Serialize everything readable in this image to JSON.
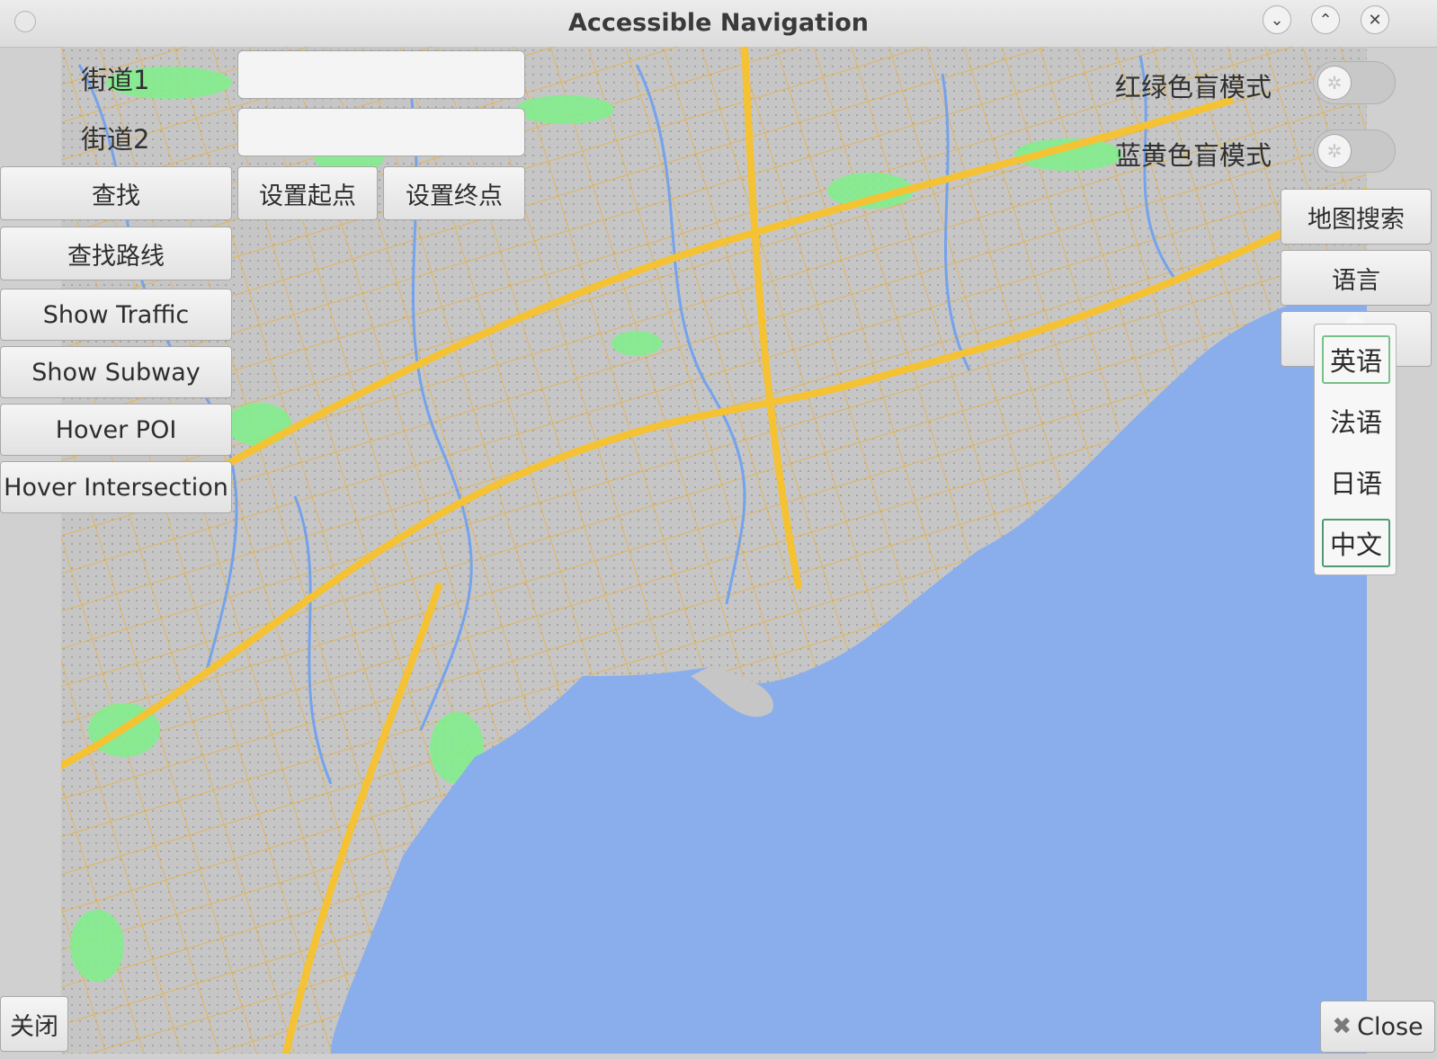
{
  "window": {
    "title": "Accessible Navigation"
  },
  "titlebar_icons": [
    "minimize-icon",
    "maximize-icon",
    "close-icon"
  ],
  "search_panel": {
    "street1_label": "街道1",
    "street2_label": "街道2",
    "street1_value": "",
    "street2_value": "",
    "find_button": "查找",
    "set_start_button": "设置起点",
    "set_end_button": "设置终点",
    "find_route_button": "查找路线",
    "show_traffic_button": "Show Traffic",
    "show_subway_button": "Show Subway",
    "hover_poi_button": "Hover POI",
    "hover_intersection_button": "Hover Intersection"
  },
  "right_panel": {
    "red_green_label": "红绿色盲模式",
    "blue_yellow_label": "蓝黄色盲模式",
    "red_green_on": false,
    "blue_yellow_on": false,
    "map_search_button": "地图搜索",
    "language_button": "语言"
  },
  "language_menu": {
    "items": [
      "英语",
      "法语",
      "日语",
      "中文"
    ],
    "focused_item": "英语",
    "selected_item": "中文"
  },
  "bottom": {
    "exit_button": "关闭",
    "close_button": "Close"
  },
  "colors": {
    "water": "#8aadec",
    "land": "#c6c6c6",
    "roads": "#f4b21e",
    "parks": "#7ff08a",
    "rivers": "#6c9ef0"
  }
}
